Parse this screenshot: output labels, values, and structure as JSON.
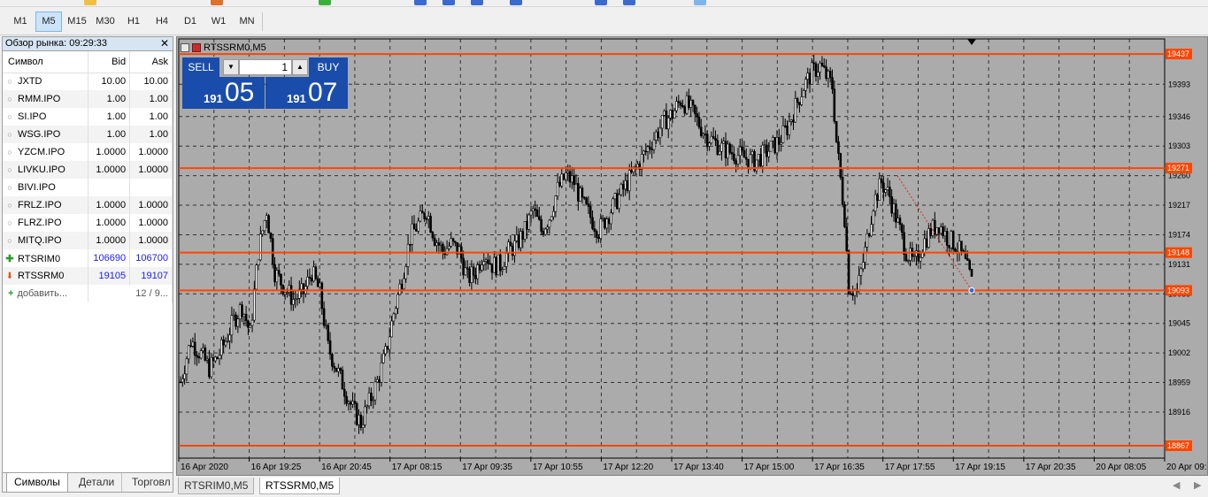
{
  "timeframes": {
    "items": [
      "M1",
      "M5",
      "M15",
      "M30",
      "H1",
      "H4",
      "D1",
      "W1",
      "MN"
    ],
    "active": "M5"
  },
  "market_watch": {
    "title": "Обзор рынка: 09:29:33",
    "columns": {
      "symbol": "Символ",
      "bid": "Bid",
      "ask": "Ask"
    },
    "rows": [
      {
        "symbol": "JXTD",
        "bid": "10.00",
        "ask": "10.00",
        "icon": "dot"
      },
      {
        "symbol": "RMM.IPO",
        "bid": "1.00",
        "ask": "1.00",
        "icon": "dot"
      },
      {
        "symbol": "SI.IPO",
        "bid": "1.00",
        "ask": "1.00",
        "icon": "dot"
      },
      {
        "symbol": "WSG.IPO",
        "bid": "1.00",
        "ask": "1.00",
        "icon": "dot"
      },
      {
        "symbol": "YZCM.IPO",
        "bid": "1.0000",
        "ask": "1.0000",
        "icon": "dot"
      },
      {
        "symbol": "LIVKU.IPO",
        "bid": "1.0000",
        "ask": "1.0000",
        "icon": "dot"
      },
      {
        "symbol": "BIVI.IPO",
        "bid": "",
        "ask": "",
        "icon": "dot"
      },
      {
        "symbol": "FRLZ.IPO",
        "bid": "1.0000",
        "ask": "1.0000",
        "icon": "dot"
      },
      {
        "symbol": "FLRZ.IPO",
        "bid": "1.0000",
        "ask": "1.0000",
        "icon": "dot"
      },
      {
        "symbol": "MITQ.IPO",
        "bid": "1.0000",
        "ask": "1.0000",
        "icon": "dot"
      },
      {
        "symbol": "RTSRIM0",
        "bid": "106690",
        "ask": "106700",
        "icon": "up-arrow"
      },
      {
        "symbol": "RTSSRM0",
        "bid": "19105",
        "ask": "19107",
        "icon": "down-arrow"
      }
    ],
    "add_label": "добавить...",
    "count_label": "12 / 9...",
    "tabs": [
      "Символы",
      "Детали",
      "Торговл"
    ],
    "active_tab": "Символы"
  },
  "chart": {
    "window_title": "RTSSRM0,M5",
    "one_click": {
      "sell_label": "SELL",
      "buy_label": "BUY",
      "lot": "1",
      "sell_small": "191",
      "sell_big": "05",
      "buy_small": "191",
      "buy_big": "07"
    },
    "colors": {
      "background": "#ababab",
      "grid": "#333333",
      "hline": "#ff4500",
      "candle": "#000000",
      "price_label_bg": "#ff4500"
    }
  },
  "chart_data": {
    "type": "candlestick",
    "symbol": "RTSSRM0",
    "timeframe": "M5",
    "ylim": [
      18849,
      19459
    ],
    "y_ticks": [
      19393,
      19346,
      19303,
      19260,
      19217,
      19174,
      19131,
      19088,
      19045,
      19002,
      18959,
      18916
    ],
    "x_ticks": [
      "16 Apr 2020",
      "16 Apr 19:25",
      "16 Apr 20:45",
      "17 Apr 08:15",
      "17 Apr 09:35",
      "17 Apr 10:55",
      "17 Apr 12:20",
      "17 Apr 13:40",
      "17 Apr 15:00",
      "17 Apr 16:35",
      "17 Apr 17:55",
      "17 Apr 19:15",
      "17 Apr 20:35",
      "20 Apr 08:05",
      "20 Apr 09:25"
    ],
    "horizontal_lines": [
      19437,
      19271,
      19148,
      19093,
      18867
    ],
    "close_path": [
      [
        0,
        18960
      ],
      [
        5,
        19020
      ],
      [
        10,
        19000
      ],
      [
        14,
        18980
      ],
      [
        18,
        18995
      ],
      [
        22,
        19020
      ],
      [
        26,
        19050
      ],
      [
        30,
        19070
      ],
      [
        34,
        19030
      ],
      [
        38,
        19150
      ],
      [
        42,
        19210
      ],
      [
        46,
        19120
      ],
      [
        50,
        19100
      ],
      [
        55,
        19080
      ],
      [
        60,
        19090
      ],
      [
        64,
        19120
      ],
      [
        68,
        19090
      ],
      [
        72,
        19010
      ],
      [
        76,
        18980
      ],
      [
        80,
        18950
      ],
      [
        84,
        18920
      ],
      [
        88,
        18900
      ],
      [
        92,
        18930
      ],
      [
        96,
        18960
      ],
      [
        100,
        19000
      ],
      [
        104,
        19060
      ],
      [
        108,
        19110
      ],
      [
        112,
        19170
      ],
      [
        116,
        19190
      ],
      [
        120,
        19210
      ],
      [
        124,
        19170
      ],
      [
        128,
        19150
      ],
      [
        132,
        19160
      ],
      [
        136,
        19150
      ],
      [
        140,
        19110
      ],
      [
        144,
        19120
      ],
      [
        148,
        19150
      ],
      [
        152,
        19130
      ],
      [
        156,
        19130
      ],
      [
        160,
        19150
      ],
      [
        164,
        19160
      ],
      [
        168,
        19180
      ],
      [
        172,
        19210
      ],
      [
        176,
        19180
      ],
      [
        180,
        19200
      ],
      [
        184,
        19240
      ],
      [
        188,
        19260
      ],
      [
        192,
        19250
      ],
      [
        196,
        19220
      ],
      [
        200,
        19200
      ],
      [
        204,
        19180
      ],
      [
        208,
        19200
      ],
      [
        212,
        19220
      ],
      [
        216,
        19240
      ],
      [
        220,
        19260
      ],
      [
        224,
        19280
      ],
      [
        228,
        19300
      ],
      [
        232,
        19320
      ],
      [
        236,
        19340
      ],
      [
        240,
        19350
      ],
      [
        244,
        19370
      ],
      [
        248,
        19360
      ],
      [
        252,
        19340
      ],
      [
        256,
        19320
      ],
      [
        260,
        19310
      ],
      [
        264,
        19300
      ],
      [
        268,
        19295
      ],
      [
        272,
        19290
      ],
      [
        276,
        19285
      ],
      [
        280,
        19280
      ],
      [
        284,
        19290
      ],
      [
        288,
        19300
      ],
      [
        292,
        19310
      ],
      [
        296,
        19330
      ],
      [
        300,
        19360
      ],
      [
        304,
        19390
      ],
      [
        308,
        19410
      ],
      [
        312,
        19420
      ],
      [
        316,
        19400
      ],
      [
        318,
        19390
      ],
      [
        320,
        19310
      ],
      [
        324,
        19200
      ],
      [
        326,
        19100
      ],
      [
        330,
        19090
      ],
      [
        334,
        19150
      ],
      [
        338,
        19220
      ],
      [
        342,
        19250
      ],
      [
        346,
        19230
      ],
      [
        350,
        19190
      ],
      [
        354,
        19150
      ],
      [
        358,
        19130
      ],
      [
        362,
        19160
      ],
      [
        366,
        19180
      ],
      [
        370,
        19190
      ],
      [
        374,
        19170
      ],
      [
        378,
        19160
      ],
      [
        382,
        19140
      ],
      [
        386,
        19105
      ]
    ]
  }
}
